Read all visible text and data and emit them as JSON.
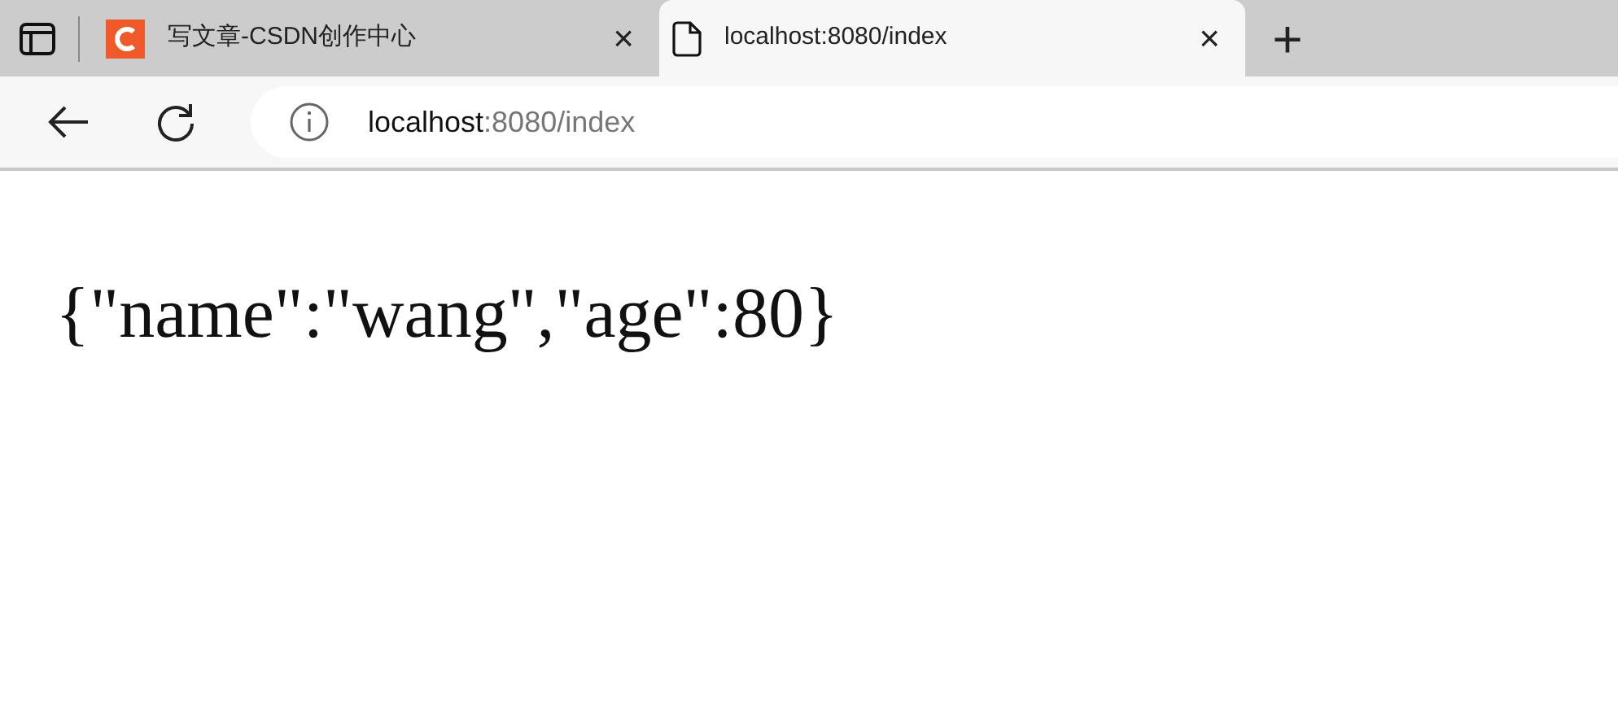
{
  "tabs": [
    {
      "kind": "site",
      "title": "写文章-CSDN创作中心",
      "close": "×",
      "selected": false
    },
    {
      "kind": "page",
      "title": "localhost:8080/index",
      "close": "×",
      "selected": true
    }
  ],
  "new_tab": "+",
  "address_bar": {
    "host": "localhost",
    "path": ":8080/index"
  },
  "page": {
    "body": "{\"name\":\"wang\",\"age\":80}"
  }
}
